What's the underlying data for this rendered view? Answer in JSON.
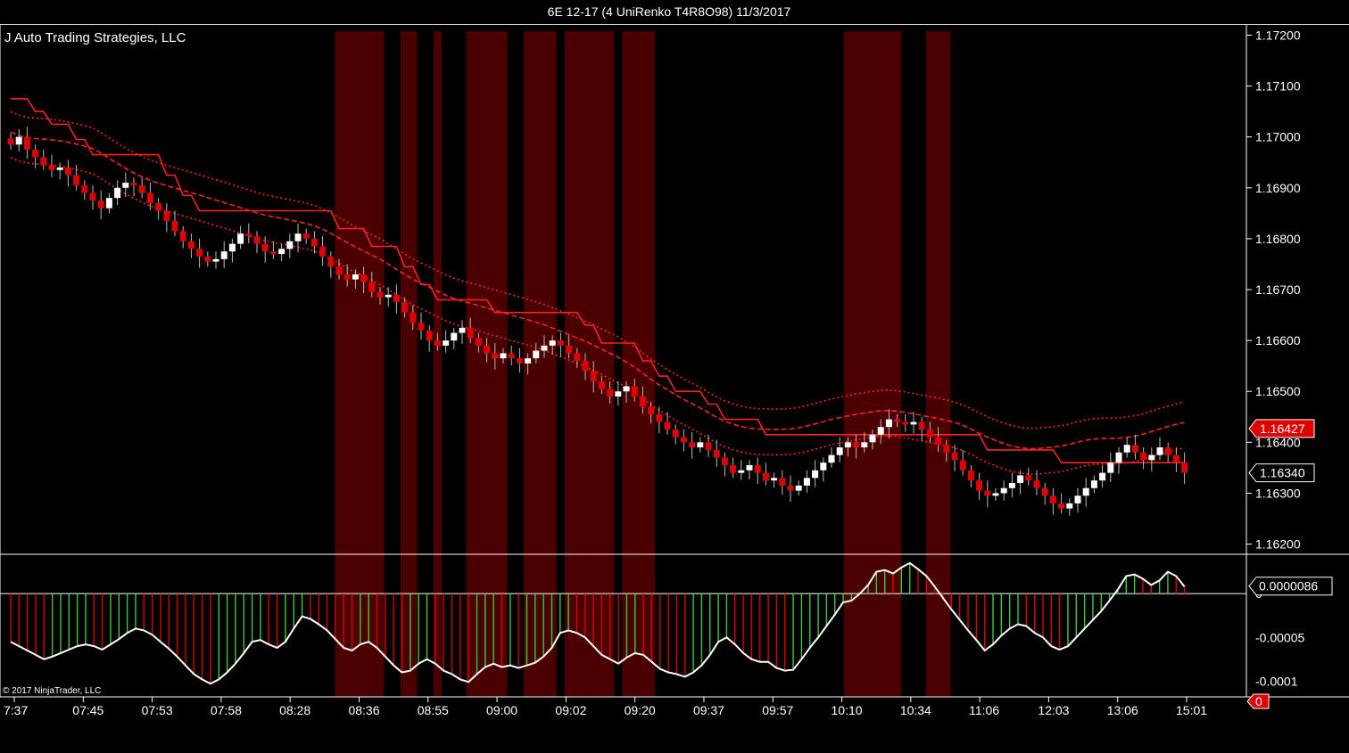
{
  "window": {
    "title": "6E 12-17 (4 UniRenko T4R8O98)  11/3/2017"
  },
  "chart_data": [
    {
      "type": "candlestick",
      "title": "",
      "label": "J Auto Trading Strategies, LLC",
      "y_axis": {
        "ticks": [
          "1.17200",
          "1.17100",
          "1.17000",
          "1.16900",
          "1.16800",
          "1.16700",
          "1.16600",
          "1.16500",
          "1.16400",
          "1.16300",
          "1.16200"
        ],
        "range": [
          1.1618,
          1.1722
        ]
      },
      "x_axis": {
        "ticks": [
          "7:37",
          "07:45",
          "07:53",
          "07:58",
          "08:28",
          "08:36",
          "08:55",
          "09:00",
          "09:02",
          "09:20",
          "09:37",
          "09:57",
          "10:10",
          "10:34",
          "11:06",
          "12:03",
          "13:06",
          "15:01"
        ]
      },
      "price_markers": [
        {
          "label": "1.16427",
          "value": 1.16427,
          "color": "#e00000"
        },
        {
          "label": "1.16340",
          "value": 1.1634,
          "color": "#000000"
        }
      ],
      "colors": {
        "up": "#ffffff",
        "down": "#e00000",
        "shade": "#4a0000",
        "line": "#ff2020",
        "highlight": "#e8e860"
      },
      "closes": [
        1.16985,
        1.17,
        1.16975,
        1.1696,
        1.16945,
        1.16935,
        1.1694,
        1.16925,
        1.16905,
        1.1689,
        1.16875,
        1.1686,
        1.1688,
        1.169,
        1.1691,
        1.16905,
        1.1689,
        1.1687,
        1.16855,
        1.16835,
        1.16815,
        1.16795,
        1.1678,
        1.16765,
        1.16755,
        1.1676,
        1.16775,
        1.1679,
        1.1681,
        1.16805,
        1.1679,
        1.16775,
        1.1677,
        1.1678,
        1.16795,
        1.1681,
        1.168,
        1.16785,
        1.16765,
        1.16745,
        1.1673,
        1.1672,
        1.1673,
        1.16715,
        1.16695,
        1.16685,
        1.1669,
        1.16675,
        1.16655,
        1.16635,
        1.1662,
        1.166,
        1.1659,
        1.166,
        1.16615,
        1.16625,
        1.16605,
        1.1659,
        1.16575,
        1.16565,
        1.16575,
        1.16565,
        1.16555,
        1.16565,
        1.1658,
        1.1659,
        1.166,
        1.1659,
        1.16575,
        1.1656,
        1.1654,
        1.1652,
        1.16505,
        1.1649,
        1.165,
        1.1651,
        1.1649,
        1.1647,
        1.16455,
        1.1644,
        1.16425,
        1.1641,
        1.164,
        1.1639,
        1.164,
        1.16385,
        1.1637,
        1.16355,
        1.1634,
        1.16345,
        1.16355,
        1.1634,
        1.16325,
        1.1633,
        1.16315,
        1.16305,
        1.16315,
        1.1633,
        1.16345,
        1.1636,
        1.16375,
        1.1639,
        1.164,
        1.1639,
        1.164,
        1.16415,
        1.1643,
        1.16445,
        1.1644,
        1.16435,
        1.1644,
        1.16425,
        1.1641,
        1.16395,
        1.1638,
        1.16365,
        1.16345,
        1.16325,
        1.16305,
        1.16295,
        1.163,
        1.1631,
        1.1632,
        1.16335,
        1.16325,
        1.1631,
        1.16295,
        1.1628,
        1.1627,
        1.1628,
        1.16295,
        1.1631,
        1.16325,
        1.1634,
        1.1636,
        1.1638,
        1.16395,
        1.1638,
        1.16365,
        1.16375,
        1.1639,
        1.16375,
        1.1636,
        1.1634
      ],
      "shaded_bar_ranges": [
        [
          40,
          45
        ],
        [
          48,
          49
        ],
        [
          52,
          52
        ],
        [
          56,
          60
        ],
        [
          63,
          66
        ],
        [
          68,
          70
        ],
        [
          71,
          73
        ],
        [
          75,
          76
        ],
        [
          77,
          78
        ],
        [
          102,
          108
        ],
        [
          112,
          114
        ]
      ]
    },
    {
      "type": "histogram",
      "title": "",
      "y_axis": {
        "ticks": [
          "0",
          "-0.00005",
          "-0.0001"
        ],
        "range": [
          -0.000118,
          4.5e-05
        ]
      },
      "marker": {
        "label": "0.0000086",
        "value": 8.6e-06
      },
      "zero_marker": "0",
      "colors": {
        "pos": "#3ccc3c",
        "neg": "#e00000",
        "line": "#ffffff"
      },
      "values": [
        -5.5e-05,
        -6e-05,
        -6.5e-05,
        -7e-05,
        -7.5e-05,
        -7.2e-05,
        -6.8e-05,
        -6.4e-05,
        -6e-05,
        -5.8e-05,
        -6e-05,
        -6.4e-05,
        -5.8e-05,
        -5.2e-05,
        -4.5e-05,
        -4e-05,
        -4.2e-05,
        -4.7e-05,
        -5.5e-05,
        -6.3e-05,
        -7.2e-05,
        -8.2e-05,
        -9.2e-05,
        -9.8e-05,
        -0.000103,
        -9.8e-05,
        -9e-05,
        -8e-05,
        -6.8e-05,
        -5.5e-05,
        -5.3e-05,
        -5.8e-05,
        -6.2e-05,
        -5.5e-05,
        -4e-05,
        -2.6e-05,
        -2.9e-05,
        -3.5e-05,
        -4.2e-05,
        -5.2e-05,
        -6.2e-05,
        -6.5e-05,
        -5.8e-05,
        -5.5e-05,
        -6.2e-05,
        -7.2e-05,
        -8.2e-05,
        -9e-05,
        -8.8e-05,
        -8e-05,
        -7.5e-05,
        -8e-05,
        -8.8e-05,
        -9.2e-05,
        -9.8e-05,
        -0.000101,
        -9.2e-05,
        -8.4e-05,
        -8e-05,
        -8.4e-05,
        -8.2e-05,
        -8.5e-05,
        -8.2e-05,
        -7.9e-05,
        -7.2e-05,
        -6.2e-05,
        -4.5e-05,
        -4.2e-05,
        -4.5e-05,
        -5e-05,
        -6e-05,
        -7e-05,
        -7.5e-05,
        -8e-05,
        -7.3e-05,
        -6.8e-05,
        -7e-05,
        -7.8e-05,
        -8.6e-05,
        -9e-05,
        -9.2e-05,
        -9.5e-05,
        -9e-05,
        -8.2e-05,
        -7e-05,
        -5.5e-05,
        -5e-05,
        -5.8e-05,
        -6.8e-05,
        -7.5e-05,
        -7.8e-05,
        -7.8e-05,
        -8.5e-05,
        -8.8e-05,
        -8.7e-05,
        -7.5e-05,
        -6.2e-05,
        -5e-05,
        -3.7e-05,
        -2.4e-05,
        -1e-05,
        -8e-06,
        0.0,
        1e-05,
        2.5e-05,
        2.7e-05,
        2.3e-05,
        3e-05,
        3.5e-05,
        2.8e-05,
        2e-05,
        8e-06,
        -5e-06,
        -1.8e-05,
        -3e-05,
        -4.2e-05,
        -5.3e-05,
        -6.5e-05,
        -5.8e-05,
        -4.8e-05,
        -4e-05,
        -3.5e-05,
        -3.7e-05,
        -4.5e-05,
        -5e-05,
        -6e-05,
        -6.4e-05,
        -6e-05,
        -5e-05,
        -4e-05,
        -3e-05,
        -2e-05,
        -8e-06,
        5e-06,
        2e-05,
        2.2e-05,
        1.7e-05,
        1e-05,
        1.5e-05,
        2.5e-05,
        2e-05,
        8e-06
      ]
    }
  ],
  "footer": {
    "copyright": "© 2017 NinjaTrader, LLC"
  }
}
